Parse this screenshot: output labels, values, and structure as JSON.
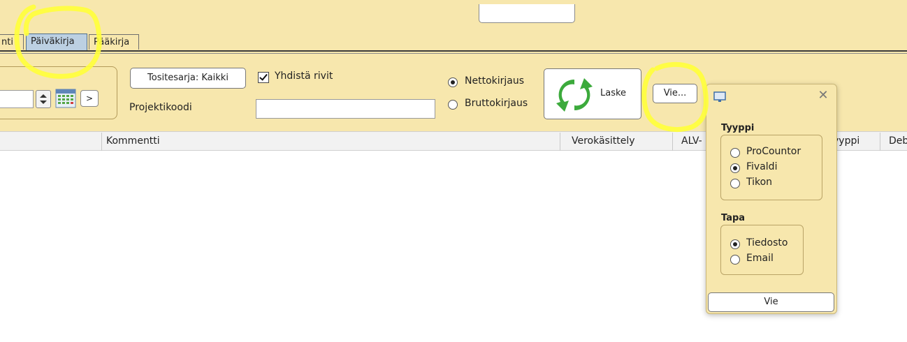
{
  "tabs": {
    "prev_partial_label": "nti",
    "paivakirja_label": "Päiväkirja",
    "paakirja_label": "Pääkirja"
  },
  "toolbar": {
    "next_label": ">",
    "tositesarja_label": "Tositesarja: Kaikki",
    "yhdista_label": "Yhdistä rivit",
    "yhdista_checked": true,
    "projektikoodi_label": "Projektikoodi",
    "projektikoodi_value": "",
    "netto_label": "Nettokirjaus",
    "brutto_label": "Bruttokirjaus",
    "netto_selected": true,
    "laske_label": "Laske",
    "vie_label": "Vie...",
    "laske_icon": "refresh-icon",
    "calendar_icon": "calendar-icon"
  },
  "table": {
    "columns": [
      "",
      "Kommentti",
      "Verokäsittely",
      "ALV-",
      "yyppi",
      "Deb"
    ]
  },
  "popup": {
    "window_icon": "monitor-icon",
    "close_label": "✕",
    "tyyppi_title": "Tyyppi",
    "tyyppi_options": [
      "ProCountor",
      "Fivaldi",
      "Tikon"
    ],
    "tyyppi_selected": "Fivaldi",
    "tapa_title": "Tapa",
    "tapa_options": [
      "Tiedosto",
      "Email"
    ],
    "tapa_selected": "Tiedosto",
    "vie_label": "Vie"
  },
  "colors": {
    "panel_bg": "#f7e7ad",
    "selected_tab": "#bcd0e2",
    "highlight": "#ffff3a",
    "laske_icon_green": "#3caa3c"
  }
}
